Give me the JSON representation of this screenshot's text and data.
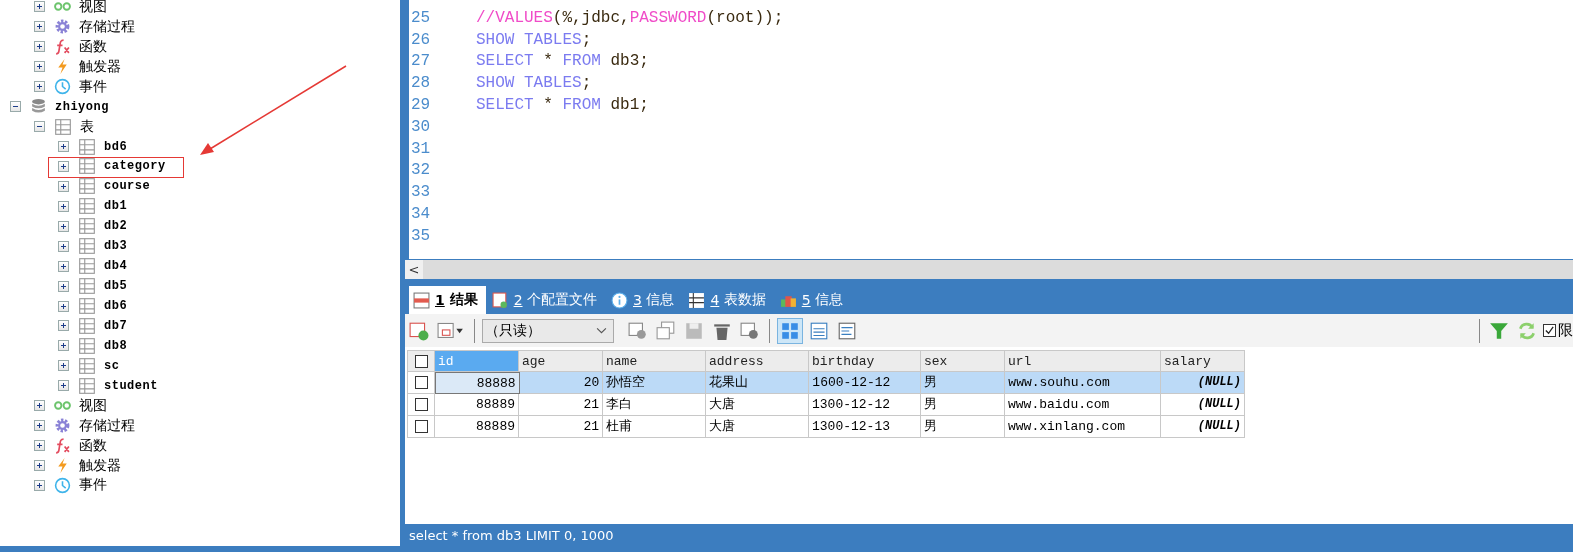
{
  "tree": {
    "partial_items": [
      {
        "label": "视图",
        "kind": "view",
        "expanded": false
      },
      {
        "label": "存储过程",
        "kind": "procedure",
        "expanded": false
      },
      {
        "label": "函数",
        "kind": "function",
        "expanded": false
      },
      {
        "label": "触发器",
        "kind": "trigger",
        "expanded": false
      },
      {
        "label": "事件",
        "kind": "event",
        "expanded": false
      }
    ],
    "databases": [
      {
        "label": "zhiyong",
        "kind": "database",
        "expanded": true,
        "children": [
          {
            "label": "表",
            "kind": "tables",
            "expanded": true,
            "children": [
              {
                "label": "bd6",
                "kind": "table",
                "expanded": false,
                "annotated": false
              },
              {
                "label": "category",
                "kind": "table",
                "expanded": false,
                "annotated": true
              },
              {
                "label": "course",
                "kind": "table",
                "expanded": false,
                "annotated": false
              },
              {
                "label": "db1",
                "kind": "table",
                "expanded": false,
                "annotated": false
              },
              {
                "label": "db2",
                "kind": "table",
                "expanded": false,
                "annotated": false
              },
              {
                "label": "db3",
                "kind": "table",
                "expanded": false,
                "annotated": false
              },
              {
                "label": "db4",
                "kind": "table",
                "expanded": false,
                "annotated": false
              },
              {
                "label": "db5",
                "kind": "table",
                "expanded": false,
                "annotated": false
              },
              {
                "label": "db6",
                "kind": "table",
                "expanded": false,
                "annotated": false
              },
              {
                "label": "db7",
                "kind": "table",
                "expanded": false,
                "annotated": false
              },
              {
                "label": "db8",
                "kind": "table",
                "expanded": false,
                "annotated": false
              },
              {
                "label": "sc",
                "kind": "table",
                "expanded": false,
                "annotated": false
              },
              {
                "label": "student",
                "kind": "table",
                "expanded": false,
                "annotated": false
              }
            ]
          },
          {
            "label": "视图",
            "kind": "view",
            "expanded": false
          },
          {
            "label": "存储过程",
            "kind": "procedure",
            "expanded": false
          },
          {
            "label": "函数",
            "kind": "function",
            "expanded": false
          },
          {
            "label": "触发器",
            "kind": "trigger",
            "expanded": false
          },
          {
            "label": "事件",
            "kind": "event",
            "expanded": false
          }
        ]
      }
    ]
  },
  "editor": {
    "lines": [
      {
        "number": "25",
        "tokens": [
          {
            "text": "//VALUES",
            "kind": "function"
          },
          {
            "text": "(%,jdbc,",
            "kind": "plain"
          },
          {
            "text": "PASSWORD",
            "kind": "function"
          },
          {
            "text": "(root));",
            "kind": "plain"
          }
        ]
      },
      {
        "number": "26",
        "tokens": [
          {
            "text": "SHOW TABLES",
            "kind": "keyword"
          },
          {
            "text": ";",
            "kind": "plain"
          }
        ]
      },
      {
        "number": "27",
        "tokens": [
          {
            "text": "SELECT",
            "kind": "keyword"
          },
          {
            "text": " * ",
            "kind": "plain"
          },
          {
            "text": "FROM",
            "kind": "keyword"
          },
          {
            "text": " db3;",
            "kind": "plain"
          }
        ]
      },
      {
        "number": "28",
        "tokens": [
          {
            "text": "SHOW TABLES",
            "kind": "keyword"
          },
          {
            "text": ";",
            "kind": "plain"
          }
        ]
      },
      {
        "number": "29",
        "tokens": [
          {
            "text": "SELECT",
            "kind": "keyword"
          },
          {
            "text": " * ",
            "kind": "plain"
          },
          {
            "text": "FROM",
            "kind": "keyword"
          },
          {
            "text": " db1;",
            "kind": "plain"
          }
        ]
      },
      {
        "number": "30"
      },
      {
        "number": "31"
      },
      {
        "number": "32"
      },
      {
        "number": "33"
      },
      {
        "number": "34"
      },
      {
        "number": "35"
      }
    ],
    "scroll_left": "<"
  },
  "result_tabs": [
    {
      "key": "1",
      "label": "结果",
      "kind": "result",
      "selected": true
    },
    {
      "key": "2",
      "label": "个配置文件",
      "kind": "profile",
      "selected": false
    },
    {
      "key": "3",
      "label": "信息",
      "kind": "info",
      "selected": false
    },
    {
      "key": "4",
      "label": "表数据",
      "kind": "tabledata",
      "selected": false
    },
    {
      "key": "5",
      "label": "信息",
      "kind": "info2",
      "selected": false
    }
  ],
  "toolbar": {
    "mode": "（只读）",
    "limit": {
      "label": "限",
      "checked": true
    }
  },
  "grid": {
    "select_all_checked": false,
    "columns": [
      {
        "name": "id",
        "kind": "number",
        "selected": true
      },
      {
        "name": "age",
        "kind": "number",
        "selected": false
      },
      {
        "name": "name",
        "kind": "text",
        "selected": false
      },
      {
        "name": "address",
        "kind": "text",
        "selected": false
      },
      {
        "name": "birthday",
        "kind": "text",
        "selected": false
      },
      {
        "name": "sex",
        "kind": "text",
        "selected": false
      },
      {
        "name": "url",
        "kind": "text",
        "selected": false
      },
      {
        "name": "salary",
        "kind": "null",
        "selected": false
      }
    ],
    "rows": [
      {
        "selected": true,
        "checked": false,
        "cells": [
          "88888",
          "20",
          "孙悟空",
          "花果山",
          "1600-12-12",
          "男",
          "www.souhu.com",
          "(NULL)"
        ]
      },
      {
        "selected": false,
        "checked": false,
        "cells": [
          "88889",
          "21",
          "李白",
          "大唐",
          "1300-12-12",
          "男",
          "www.baidu.com",
          "(NULL)"
        ]
      },
      {
        "selected": false,
        "checked": false,
        "cells": [
          "88889",
          "21",
          "杜甫",
          "大唐",
          "1300-12-13",
          "男",
          "www.xinlang.com",
          "(NULL)"
        ]
      }
    ]
  },
  "status_bar": "select * from db3 LIMIT 0, 1000"
}
